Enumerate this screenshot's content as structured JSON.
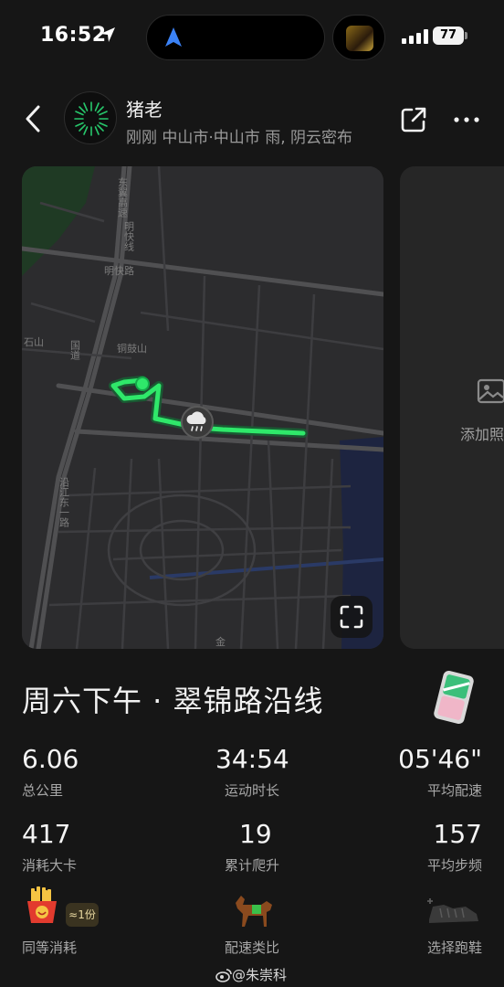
{
  "status_bar": {
    "time": "16:52",
    "battery": "77"
  },
  "header": {
    "user_name": "猪老",
    "meta": "刚刚 中山市·中山市 雨, 阴云密布"
  },
  "map": {
    "labels": [
      {
        "text": "东翼高速",
        "id": "road-1"
      },
      {
        "text": "明快线",
        "id": "road-2"
      },
      {
        "text": "明快路",
        "id": "road-3"
      },
      {
        "text": "铜鼓山",
        "id": "hill"
      },
      {
        "text": "石山",
        "id": "area"
      },
      {
        "text": "国道",
        "id": "road-4"
      },
      {
        "text": "沿江东一路",
        "id": "road-5"
      },
      {
        "text": "金",
        "id": "road-6"
      }
    ],
    "route_color": "#2fe86a",
    "add_photo": "添加照"
  },
  "activity": {
    "title": "周六下午 · 翠锦路沿线"
  },
  "stats": [
    {
      "value": "6.06",
      "label": "总公里"
    },
    {
      "value": "34:54",
      "label": "运动时长"
    },
    {
      "value": "05'46\"",
      "label": "平均配速"
    },
    {
      "value": "417",
      "label": "消耗大卡"
    },
    {
      "value": "19",
      "label": "累计爬升"
    },
    {
      "value": "157",
      "label": "平均步频"
    }
  ],
  "extras": {
    "food_portion": "≈1份",
    "equivalent_label": "同等消耗",
    "pace_label": "配速类比",
    "shoe_label": "选择跑鞋"
  },
  "watermark": "@朱崇科"
}
